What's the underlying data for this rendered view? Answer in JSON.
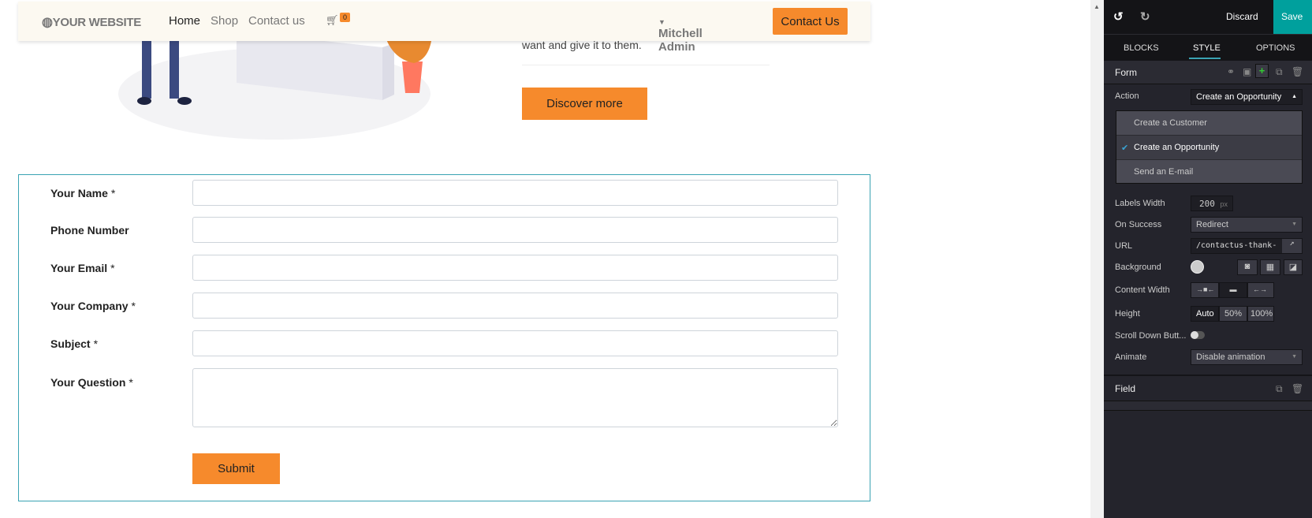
{
  "navbar": {
    "logo": "YOUR WEBSITE",
    "links": [
      "Home",
      "Shop",
      "Contact us"
    ],
    "cart_count": "0",
    "user": "Mitchell Admin",
    "cta": "Contact Us"
  },
  "hero": {
    "text": "want and give it to them.",
    "button": "Discover more"
  },
  "form": {
    "fields": [
      {
        "label": "Your Name",
        "required": "*"
      },
      {
        "label": "Phone Number",
        "required": ""
      },
      {
        "label": "Your Email",
        "required": "*"
      },
      {
        "label": "Your Company",
        "required": "*"
      },
      {
        "label": "Subject",
        "required": "*"
      },
      {
        "label": "Your Question",
        "required": "*"
      }
    ],
    "submit": "Submit"
  },
  "editor": {
    "discard": "Discard",
    "save": "Save",
    "accent": "#00a09d",
    "tabs": [
      "BLOCKS",
      "STYLE",
      "OPTIONS"
    ],
    "active_tab": "STYLE",
    "form_section": "Form",
    "action_label": "Action",
    "action_value": "Create an Opportunity",
    "action_options": [
      "Create a Customer",
      "Create an Opportunity",
      "Send an E-mail"
    ],
    "labels_width_label": "Labels Width",
    "labels_width_value": "200",
    "labels_width_unit": "px",
    "on_success_label": "On Success",
    "on_success_value": "Redirect",
    "url_label": "URL",
    "url_value": "/contactus-thank-",
    "background_label": "Background",
    "content_width_label": "Content Width",
    "height_label": "Height",
    "height_options": [
      "Auto",
      "50%",
      "100%"
    ],
    "scroll_label": "Scroll Down Butt...",
    "scroll_enabled": false,
    "animate_label": "Animate",
    "animate_value": "Disable animation",
    "field_section": "Field"
  }
}
